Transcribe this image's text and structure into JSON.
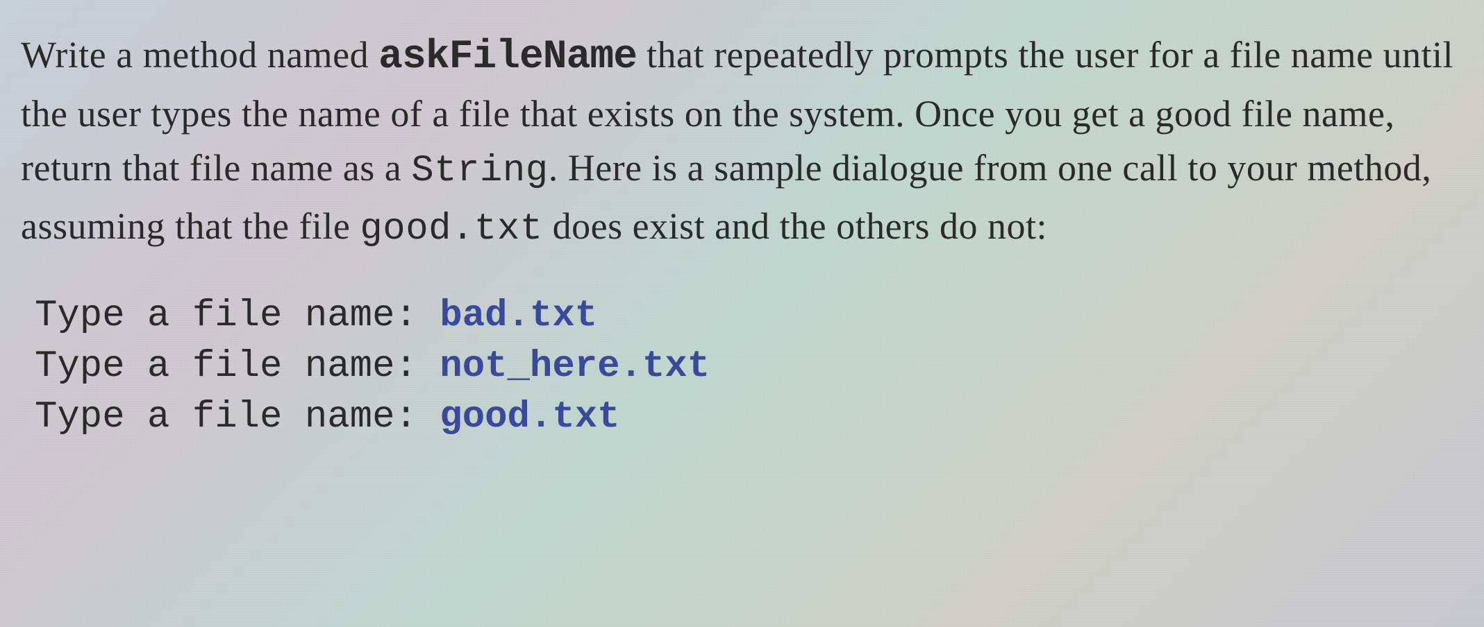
{
  "paragraph": {
    "text1": "Write a method named ",
    "methodName": "askFileName",
    "text2": " that repeatedly prompts the user for a file name until the user types the name of a file that exists on the system. Once you get a good file name, return that file name as a ",
    "returnType": "String",
    "text3": ". Here is a sample dialogue from one call to your method, assuming that the file ",
    "goodFile": "good.txt",
    "text4": " does exist and the others do not:"
  },
  "dialogue": {
    "lines": [
      {
        "prompt": "Type a file name: ",
        "input": "bad.txt"
      },
      {
        "prompt": "Type a file name: ",
        "input": "not_here.txt"
      },
      {
        "prompt": "Type a file name: ",
        "input": "good.txt"
      }
    ]
  }
}
